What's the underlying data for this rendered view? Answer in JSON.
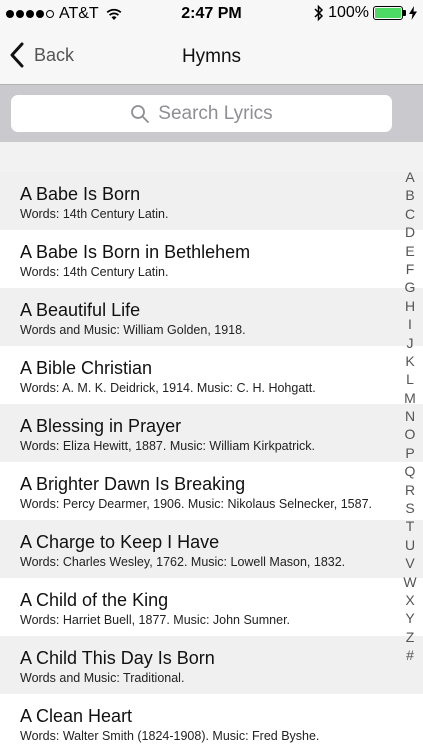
{
  "status_bar": {
    "carrier": "AT&T",
    "time": "2:47 PM",
    "battery": "100%",
    "battery_color": "#4cd964",
    "icons": [
      "signal-dots-icon",
      "wifi-icon",
      "bluetooth-icon",
      "battery-icon",
      "charging-bolt-icon"
    ]
  },
  "nav": {
    "back_label": "Back",
    "title": "Hymns",
    "back_icon": "chevron-left-icon"
  },
  "search": {
    "placeholder": "Search Lyrics",
    "icon": "search-icon"
  },
  "hymns": [
    {
      "title": "A Babe Is Born",
      "credit": "Words: 14th Century Latin."
    },
    {
      "title": "A Babe Is Born in Bethlehem",
      "credit": "Words: 14th Century Latin."
    },
    {
      "title": "A Beautiful Life",
      "credit": "Words and Music: William Golden, 1918."
    },
    {
      "title": "A Bible Christian",
      "credit": "Words: A. M. K. Deidrick, 1914. Music: C. H. Hohgatt."
    },
    {
      "title": "A Blessing in Prayer",
      "credit": "Words: Eliza Hewitt, 1887. Music: William Kirkpatrick."
    },
    {
      "title": "A Brighter Dawn Is Breaking",
      "credit": "Words: Percy Dearmer, 1906. Music: Nikolaus Selnecker, 1587."
    },
    {
      "title": "A Charge to Keep I Have",
      "credit": "Words: Charles Wesley, 1762. Music: Lowell Mason, 1832."
    },
    {
      "title": "A Child of the King",
      "credit": "Words: Harriet Buell, 1877. Music: John Sumner."
    },
    {
      "title": "A Child This Day Is Born",
      "credit": "Words and Music: Traditional."
    },
    {
      "title": "A Clean Heart",
      "credit": "Words: Walter Smith (1824-1908). Music: Fred Byshe."
    }
  ],
  "index": [
    "A",
    "B",
    "C",
    "D",
    "E",
    "F",
    "G",
    "H",
    "I",
    "J",
    "K",
    "L",
    "M",
    "N",
    "O",
    "P",
    "Q",
    "R",
    "S",
    "T",
    "U",
    "V",
    "W",
    "X",
    "Y",
    "Z",
    "#"
  ]
}
